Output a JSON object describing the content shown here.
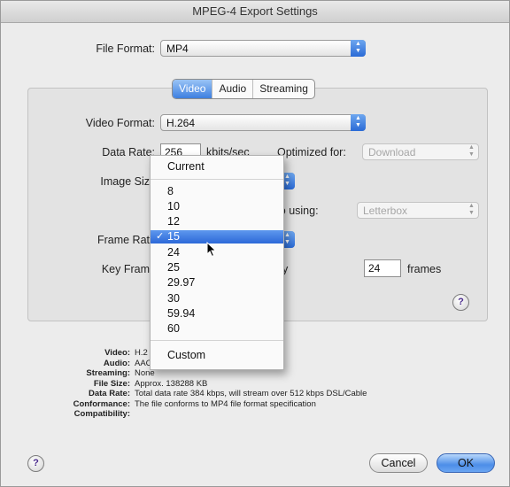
{
  "window": {
    "title": "MPEG-4 Export Settings"
  },
  "file_format": {
    "label": "File Format:",
    "value": "MP4"
  },
  "tabs": [
    {
      "label": "Video",
      "selected": true
    },
    {
      "label": "Audio",
      "selected": false
    },
    {
      "label": "Streaming",
      "selected": false
    }
  ],
  "video": {
    "format_label": "Video Format:",
    "format_value": "H.264",
    "data_rate_label": "Data Rate:",
    "data_rate_value": "256",
    "data_rate_units": "kbits/sec",
    "optimized_label": "Optimized for:",
    "optimized_value": "Download",
    "image_size_label": "Image Siz",
    "ratio_label": "io using:",
    "ratio_value": "Letterbox",
    "frame_rate_label": "Frame Rat",
    "key_frame_label": "Key Fram",
    "key_frame_suffix": "y",
    "key_frame_value": "24",
    "key_frame_units": "frames"
  },
  "frame_rate_menu": {
    "items": [
      "Current",
      "8",
      "10",
      "12",
      "15",
      "24",
      "25",
      "29.97",
      "30",
      "59.94",
      "60",
      "Custom"
    ],
    "selected": "15",
    "check_glyph": "✓"
  },
  "summary": {
    "rows": [
      {
        "key": "Video:",
        "value": "H.2                  bps, 15.00 fps"
      },
      {
        "key": "Audio:",
        "value": "AAC                              Hz, 44.100 kHz"
      },
      {
        "key": "Streaming:",
        "value": "None"
      },
      {
        "key": "File Size:",
        "value": "Approx. 138288 KB"
      },
      {
        "key": "Data Rate:",
        "value": "Total data rate 384 kbps, will stream over 512 kbps DSL/Cable"
      },
      {
        "key": "Conformance:",
        "value": "The file conforms to MP4 file format specification"
      },
      {
        "key": "Compatibility:",
        "value": ""
      }
    ]
  },
  "buttons": {
    "cancel": "Cancel",
    "ok": "OK",
    "help": "?"
  },
  "colors": {
    "accent": "#2c68d8",
    "help_mark": "#4a2a8c"
  },
  "icons": {
    "popup_arrows": "updown-arrows-icon",
    "help": "help-icon",
    "cursor": "mouse-pointer-icon",
    "check": "checkmark-icon"
  }
}
